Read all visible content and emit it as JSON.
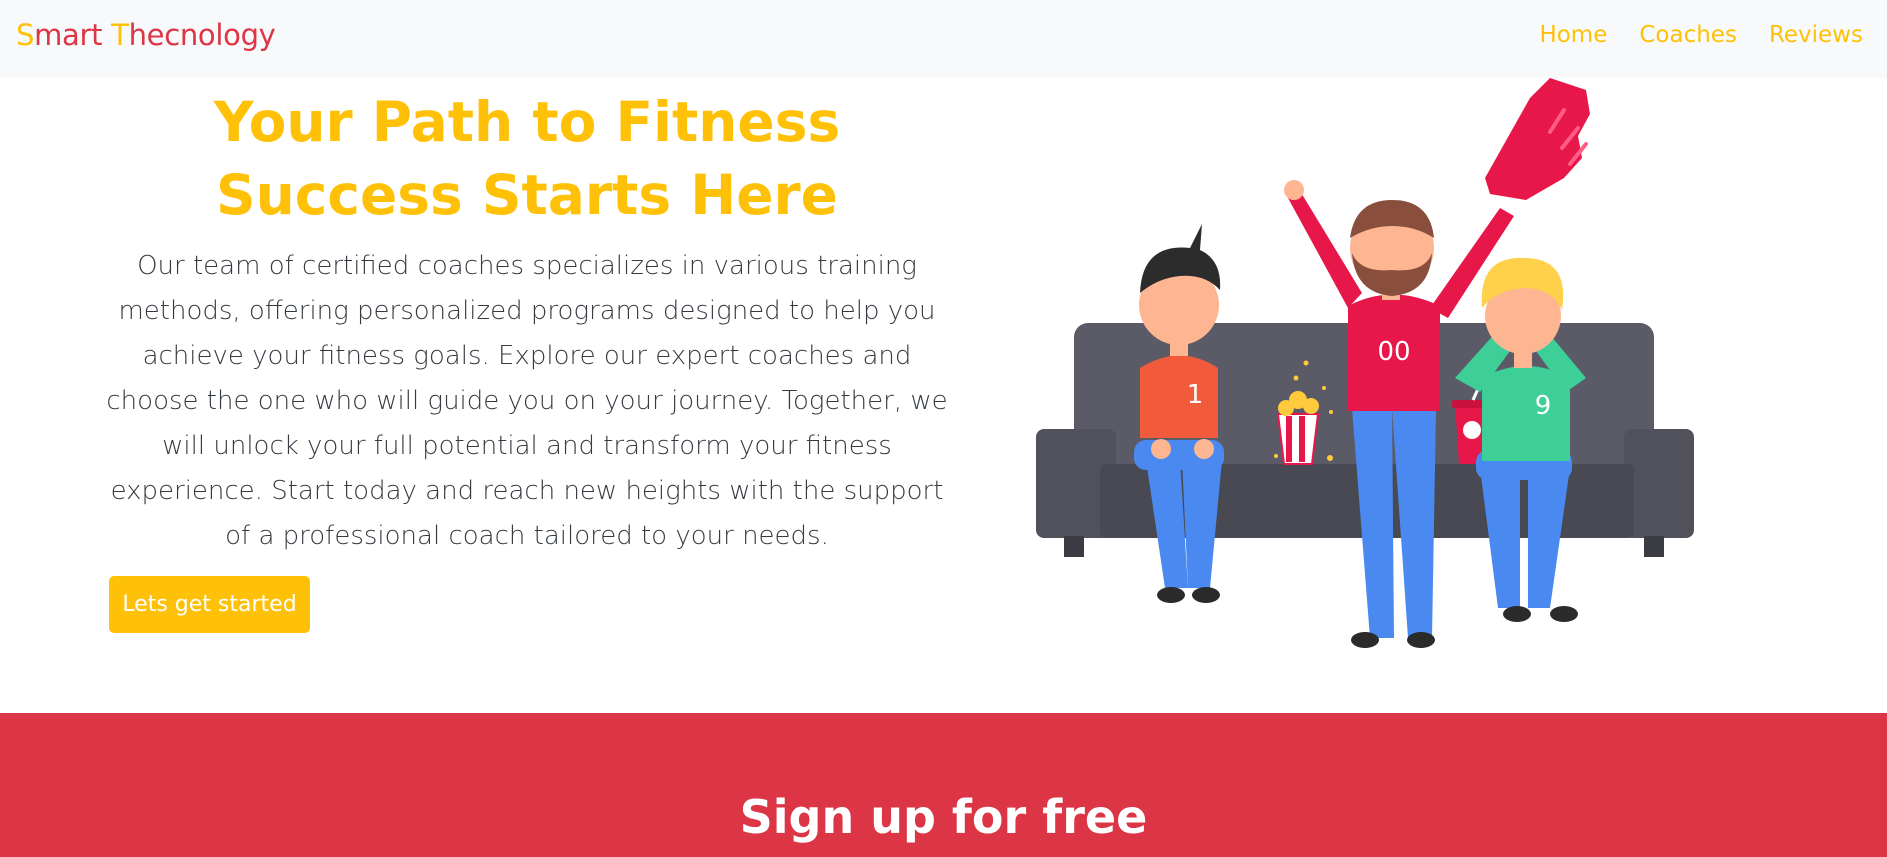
{
  "navbar": {
    "brand_part1": "S",
    "brand_part2": "mart ",
    "brand_part3": "T",
    "brand_part4": "hecnology",
    "links": [
      "Home",
      "Coaches",
      "Reviews"
    ]
  },
  "hero": {
    "title": "Your Path to Fitness Success Starts Here",
    "text": "Our team of certified coaches specializes in various training methods, offering personalized programs designed to help you achieve your fitness goals. Explore our expert coaches and choose the one who will guide you on your journey. Together, we will unlock your full potential and transform your fitness experience. Start today and reach new heights with the support of a professional coach tailored to your needs.",
    "cta_label": "Lets get started",
    "illustration": {
      "jersey_left": "1",
      "jersey_middle": "00",
      "jersey_right": "9"
    }
  },
  "signup": {
    "title": "Sign up for free"
  },
  "colors": {
    "accent": "#ffc107",
    "brand_red": "#dc3545",
    "navbar_bg": "#f8f9fa",
    "text": "#343a40"
  }
}
